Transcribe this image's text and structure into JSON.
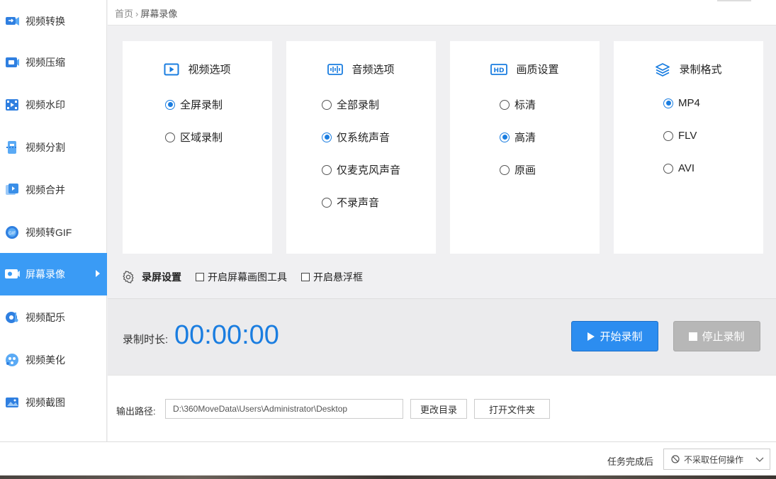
{
  "sidebar": {
    "items": [
      {
        "label": "视频转换",
        "icon": "video-convert-icon"
      },
      {
        "label": "视频压缩",
        "icon": "video-compress-icon"
      },
      {
        "label": "视频水印",
        "icon": "video-watermark-icon"
      },
      {
        "label": "视频分割",
        "icon": "video-split-icon"
      },
      {
        "label": "视频合并",
        "icon": "video-merge-icon"
      },
      {
        "label": "视频转GIF",
        "icon": "video-gif-icon"
      },
      {
        "label": "屏幕录像",
        "icon": "screen-record-icon",
        "active": true
      },
      {
        "label": "视频配乐",
        "icon": "video-music-icon"
      },
      {
        "label": "视频美化",
        "icon": "video-beautify-icon"
      },
      {
        "label": "视频截图",
        "icon": "video-screenshot-icon"
      }
    ]
  },
  "breadcrumb": {
    "home": "首页",
    "sep": "›",
    "current": "屏幕录像"
  },
  "cards": {
    "video": {
      "title": "视频选项",
      "icon": "play-box-icon",
      "options": [
        "全屏录制",
        "区域录制"
      ],
      "selected": 0
    },
    "audio": {
      "title": "音频选项",
      "icon": "audio-wave-icon",
      "options": [
        "全部录制",
        "仅系统声音",
        "仅麦克风声音",
        "不录声音"
      ],
      "selected": 1
    },
    "quality": {
      "title": "画质设置",
      "icon": "hd-icon",
      "options": [
        "标清",
        "高清",
        "原画"
      ],
      "selected": 1
    },
    "format": {
      "title": "录制格式",
      "icon": "layers-icon",
      "options": [
        "MP4",
        "FLV",
        "AVI"
      ],
      "selected": 0
    }
  },
  "settings": {
    "title": "录屏设置",
    "options": [
      "开启屏幕画图工具",
      "开启悬浮框"
    ]
  },
  "timer": {
    "label": "录制时长:",
    "value": "00:00:00"
  },
  "buttons": {
    "start": "开始录制",
    "stop": "停止录制"
  },
  "output": {
    "label": "输出路径:",
    "path": "D:\\360MoveData\\Users\\Administrator\\Desktop",
    "change_dir": "更改目录",
    "open_folder": "打开文件夹"
  },
  "after": {
    "label": "任务完成后",
    "value": "不采取任何操作"
  },
  "colors": {
    "accent": "#3a9bf5",
    "timer": "#1a7de0",
    "stop_btn": "#b7b7b7"
  }
}
